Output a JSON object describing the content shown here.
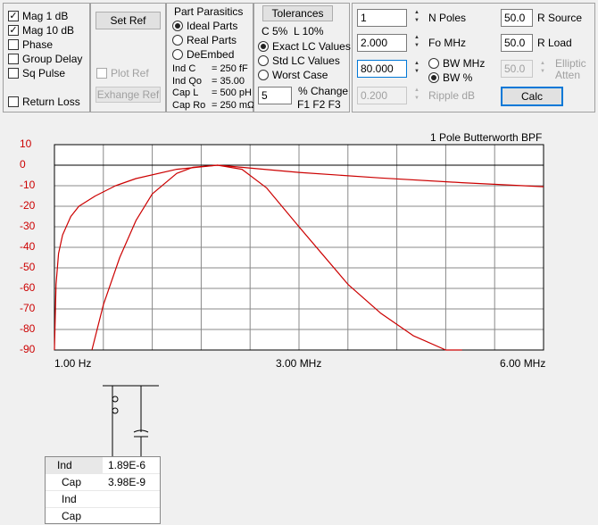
{
  "display_options": {
    "mag_1db": {
      "label": "Mag   1 dB",
      "checked": true
    },
    "mag_10db": {
      "label": "Mag 10 dB",
      "checked": true
    },
    "phase": {
      "label": "Phase",
      "checked": false
    },
    "group_delay": {
      "label": "Group Delay",
      "checked": false
    },
    "sq_pulse": {
      "label": "Sq Pulse",
      "checked": false
    },
    "return_loss": {
      "label": "Return Loss",
      "checked": false
    }
  },
  "reference": {
    "set_ref": "Set Ref",
    "plot_ref": "Plot Ref",
    "exchange_ref": "Exhange Ref"
  },
  "parasitics": {
    "title": "Part Parasitics",
    "options": [
      "Ideal Parts",
      "Real Parts",
      "DeEmbed"
    ],
    "selected": "Ideal Parts",
    "rows": [
      {
        "label": "Ind C",
        "value": "250 fF"
      },
      {
        "label": "Ind Qo",
        "value": "35.00"
      },
      {
        "label": "Cap L",
        "value": "500 pH"
      },
      {
        "label": "Cap Ro",
        "value": "250 mΩ"
      }
    ]
  },
  "tolerances": {
    "button": "Tolerances",
    "c_tol": "C 5%",
    "l_tol": "L 10%",
    "options": [
      "Exact LC Values",
      "Std LC Values",
      "Worst Case"
    ],
    "selected": "Exact LC Values",
    "change_value": "5",
    "change_label": "% Change",
    "f_labels": "F1 F2 F3"
  },
  "design": {
    "n_poles": {
      "value": "1",
      "label": "N Poles"
    },
    "fo": {
      "value": "2.000",
      "label": "Fo  MHz"
    },
    "bw": {
      "value": "80.000"
    },
    "bw_options": [
      "BW MHz",
      "BW %"
    ],
    "bw_selected": "BW %",
    "ripple": {
      "value": "0.200",
      "label": "Ripple  dB"
    },
    "r_source": {
      "value": "50.0",
      "label": "R Source"
    },
    "r_load": {
      "value": "50.0",
      "label": "R Load"
    },
    "elliptic": {
      "value": "50.0",
      "label1": "Elliptic",
      "label2": "Atten"
    },
    "calc": "Calc"
  },
  "chart_data": {
    "type": "line",
    "title": "1 Pole Butterworth BPF",
    "xlabel": "",
    "ylabel": "",
    "x_tick_labels": [
      "1.00 Hz",
      "3.00 MHz",
      "6.00 MHz"
    ],
    "xlim": [
      0,
      6
    ],
    "ylim": [
      -90,
      10
    ],
    "y_ticks": [
      10,
      0,
      -10,
      -20,
      -30,
      -40,
      -50,
      -60,
      -70,
      -80,
      -90
    ],
    "grid": true,
    "series": [
      {
        "label": "Mag 1 dB",
        "color": "#cc0000",
        "x": [
          0.46,
          0.6,
          0.8,
          1.0,
          1.2,
          1.5,
          1.7,
          2.0,
          2.3,
          2.6,
          3.0,
          3.3,
          3.6,
          4.0,
          4.4,
          4.8,
          5.0
        ],
        "y": [
          -90,
          -68,
          -45,
          -27,
          -14,
          -4,
          -1,
          0,
          -2,
          -11,
          -30,
          -44,
          -58,
          -72,
          -83,
          -90,
          -90
        ]
      },
      {
        "label": "Mag 10 dB",
        "color": "#cc0000",
        "x": [
          0.0,
          0.02,
          0.05,
          0.1,
          0.2,
          0.3,
          0.5,
          0.75,
          1.0,
          1.5,
          2.0,
          3.0,
          4.0,
          5.0,
          6.0
        ],
        "y": [
          -90,
          -58,
          -43,
          -34,
          -25,
          -20,
          -15,
          -10,
          -6.5,
          -2,
          0,
          -3.5,
          -6.2,
          -8.5,
          -10.5
        ]
      }
    ]
  },
  "schematic_table": {
    "rows": [
      {
        "label": "Ind",
        "value": "1.89E-6"
      },
      {
        "label": "Cap",
        "value": "3.98E-9"
      },
      {
        "label": "Ind",
        "value": ""
      },
      {
        "label": "Cap",
        "value": ""
      }
    ]
  },
  "colors": {
    "plot_line": "#cc0000",
    "axis_text": "#cc0000",
    "focus": "#0078d7"
  }
}
